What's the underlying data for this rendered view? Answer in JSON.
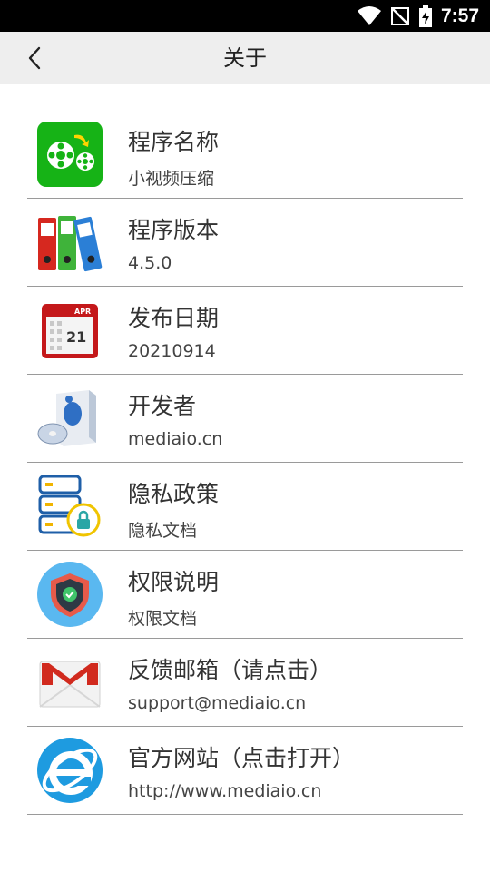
{
  "status_bar": {
    "time": "7:57",
    "icons": [
      "wifi-icon",
      "no-signal-icon",
      "battery-charging-icon"
    ]
  },
  "app_bar": {
    "title": "关于",
    "back_icon": "chevron-left-icon"
  },
  "items": [
    {
      "label": "程序名称",
      "value": "小视频压缩",
      "icon": "film-reel-icon"
    },
    {
      "label": "程序版本",
      "value": "4.5.0",
      "icon": "binders-icon"
    },
    {
      "label": "发布日期",
      "value": "20210914",
      "icon": "calendar-icon"
    },
    {
      "label": "开发者",
      "value": "mediaio.cn",
      "icon": "software-box-icon"
    },
    {
      "label": "隐私政策",
      "value": "隐私文档",
      "icon": "server-lock-icon"
    },
    {
      "label": "权限说明",
      "value": "权限文档",
      "icon": "shield-check-icon"
    },
    {
      "label": "反馈邮箱（请点击）",
      "value": "support@mediaio.cn",
      "icon": "mail-icon"
    },
    {
      "label": "官方网站（点击打开）",
      "value": "http://www.mediaio.cn",
      "icon": "ie-browser-icon"
    }
  ],
  "calendar_icon_text": {
    "month": "APR",
    "day": "21"
  }
}
